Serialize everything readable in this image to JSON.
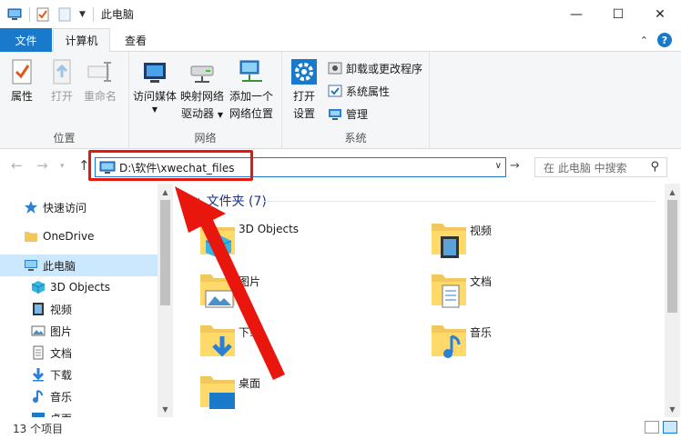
{
  "window": {
    "title": "此电脑",
    "minimize": "—",
    "maximize": "☐",
    "close": "✕"
  },
  "ribbon_tabs": {
    "file": "文件",
    "computer": "计算机",
    "view": "查看"
  },
  "ribbon": {
    "location_group": {
      "label": "位置",
      "properties": "属性",
      "open": "打开",
      "rename": "重命名"
    },
    "network_group": {
      "label": "网络",
      "access_media_1": "访问媒体",
      "map_drive_1": "映射网络",
      "map_drive_2": "驱动器",
      "add_location_1": "添加一个",
      "add_location_2": "网络位置"
    },
    "system_group": {
      "label": "系统",
      "open_settings_1": "打开",
      "open_settings_2": "设置",
      "uninstall": "卸载或更改程序",
      "system_properties": "系统属性",
      "manage": "管理"
    }
  },
  "address_bar": {
    "path": "D:\\软件\\xwechat_files",
    "search_placeholder": "在 此电脑 中搜索"
  },
  "nav_pane": {
    "items": [
      {
        "label": "快速访问",
        "icon": "star-icon"
      },
      {
        "label": "OneDrive",
        "icon": "folder-icon"
      },
      {
        "label": "此电脑",
        "icon": "pc-icon",
        "selected": true
      },
      {
        "label": "3D Objects",
        "icon": "cube-icon"
      },
      {
        "label": "视频",
        "icon": "video-icon"
      },
      {
        "label": "图片",
        "icon": "picture-icon"
      },
      {
        "label": "文档",
        "icon": "document-icon"
      },
      {
        "label": "下载",
        "icon": "download-icon"
      },
      {
        "label": "音乐",
        "icon": "music-icon"
      },
      {
        "label": "桌面",
        "icon": "desktop-icon"
      }
    ]
  },
  "main": {
    "section_title": "文件夹 (7)",
    "folders": [
      {
        "name": "3D Objects",
        "icon": "3d-objects-folder-icon"
      },
      {
        "name": "视频",
        "icon": "video-folder-icon"
      },
      {
        "name": "图片",
        "icon": "pictures-folder-icon"
      },
      {
        "name": "文档",
        "icon": "documents-folder-icon"
      },
      {
        "name": "下载",
        "icon": "downloads-folder-icon"
      },
      {
        "name": "音乐",
        "icon": "music-folder-icon"
      },
      {
        "name": "桌面",
        "icon": "desktop-folder-icon"
      }
    ]
  },
  "status_bar": {
    "item_count": "13 个项目"
  },
  "colors": {
    "accent": "#1979ca",
    "annotation_red": "#e8160c",
    "selection": "#cce8ff",
    "section_title": "#1e3287"
  }
}
